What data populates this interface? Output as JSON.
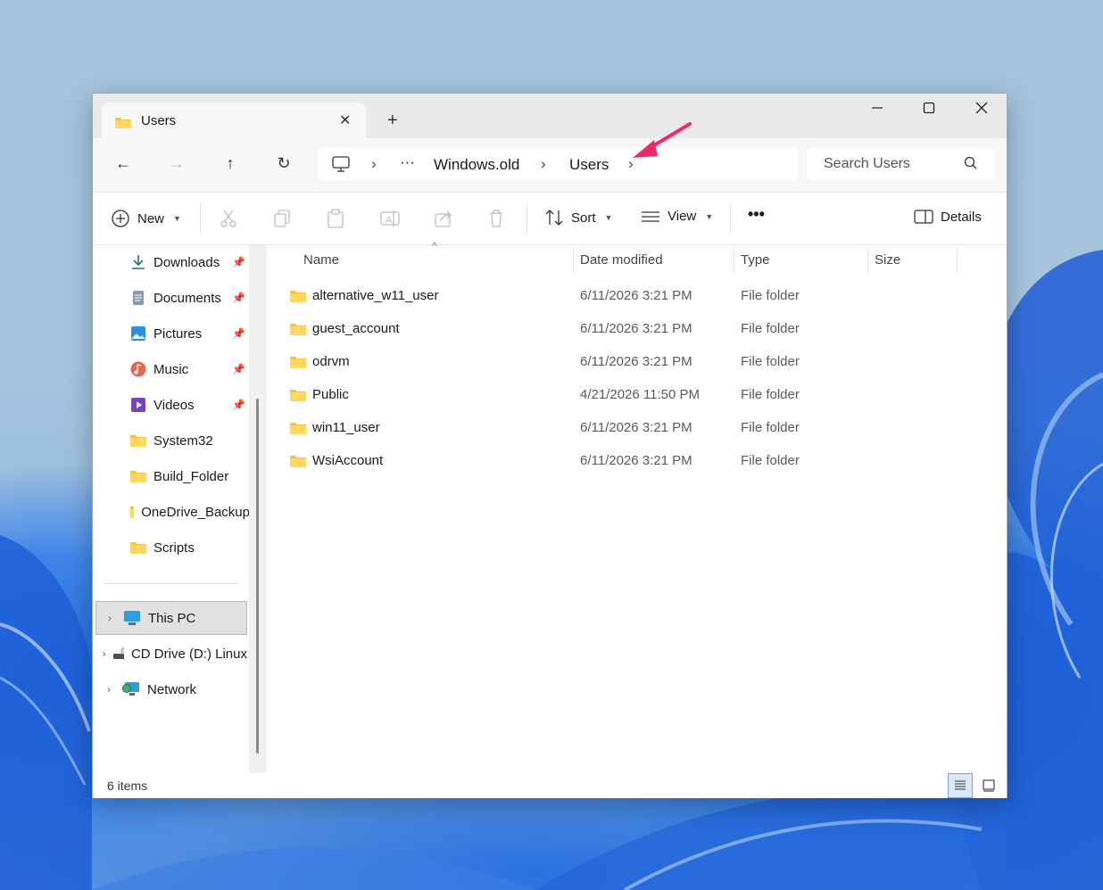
{
  "tab": {
    "title": "Users",
    "close": "✕",
    "new": "+"
  },
  "window_controls": {
    "minimize": "—",
    "maximize": "☐",
    "close": "✕"
  },
  "nav": {
    "back": "←",
    "forward": "→",
    "up": "↑",
    "refresh": "↻"
  },
  "address": {
    "more": "···",
    "crumbs": [
      "Windows.old",
      "Users"
    ],
    "sep": "›"
  },
  "search": {
    "placeholder": "Search Users"
  },
  "toolbar": {
    "new_label": "New",
    "sort_label": "Sort",
    "view_label": "View",
    "more": "•••",
    "details_label": "Details"
  },
  "sidebar": {
    "quick": [
      {
        "label": "Downloads",
        "icon": "download-icon",
        "pinned": true
      },
      {
        "label": "Documents",
        "icon": "document-icon",
        "pinned": true
      },
      {
        "label": "Pictures",
        "icon": "pictures-icon",
        "pinned": true
      },
      {
        "label": "Music",
        "icon": "music-icon",
        "pinned": true
      },
      {
        "label": "Videos",
        "icon": "videos-icon",
        "pinned": true
      },
      {
        "label": "System32",
        "icon": "folder-icon",
        "pinned": false
      },
      {
        "label": "Build_Folder",
        "icon": "folder-icon",
        "pinned": false
      },
      {
        "label": "OneDrive_Backup",
        "icon": "folder-icon",
        "pinned": false
      },
      {
        "label": "Scripts",
        "icon": "folder-icon",
        "pinned": false
      }
    ],
    "tree": [
      {
        "label": "This PC",
        "icon": "computer-icon",
        "selected": true
      },
      {
        "label": "CD Drive (D:) Linux",
        "icon": "cd-drive-icon",
        "selected": false
      },
      {
        "label": "Network",
        "icon": "network-icon",
        "selected": false
      }
    ],
    "expand": "›"
  },
  "columns": {
    "name": "Name",
    "date": "Date modified",
    "type": "Type",
    "size": "Size",
    "sort_indicator": "^"
  },
  "files": [
    {
      "name": "alternative_w11_user",
      "date": "6/11/2026 3:21 PM",
      "type": "File folder",
      "size": ""
    },
    {
      "name": "guest_account",
      "date": "6/11/2026 3:21 PM",
      "type": "File folder",
      "size": ""
    },
    {
      "name": "odrvm",
      "date": "6/11/2026 3:21 PM",
      "type": "File folder",
      "size": ""
    },
    {
      "name": "Public",
      "date": "4/21/2026 11:50 PM",
      "type": "File folder",
      "size": ""
    },
    {
      "name": "win11_user",
      "date": "6/11/2026 3:21 PM",
      "type": "File folder",
      "size": ""
    },
    {
      "name": "WsiAccount",
      "date": "6/11/2026 3:21 PM",
      "type": "File folder",
      "size": ""
    }
  ],
  "status": {
    "count": "6 items"
  },
  "colors": {
    "folder": "#f4c542",
    "arrow": "#f0296e",
    "accent": "#1a73d9"
  }
}
